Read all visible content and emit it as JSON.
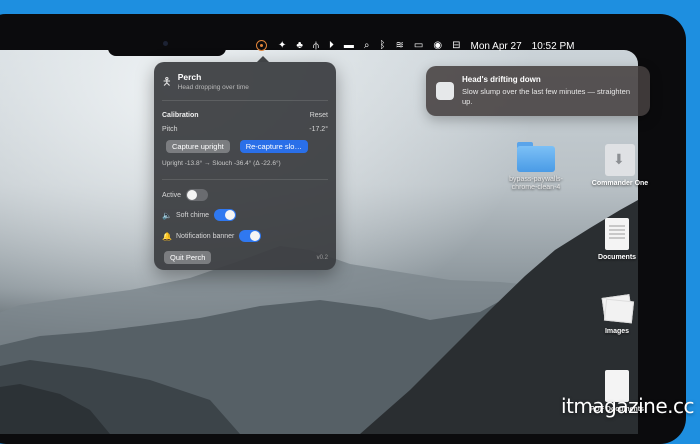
{
  "menubar": {
    "icons": [
      "perch-icon",
      "sparkle-icon",
      "badge-app-icon",
      "stand-icon",
      "play-circle-icon",
      "bed-icon",
      "search-icon",
      "bluetooth-icon",
      "wifi-icon",
      "battery-icon",
      "siri-icon",
      "control-center-icon"
    ],
    "date": "Mon Apr 27",
    "time": "10:52 PM"
  },
  "popover": {
    "app_name": "Perch",
    "subtitle": "Head dropping over time",
    "calibration_label": "Calibration",
    "reset_label": "Reset",
    "pitch_label": "Pitch",
    "pitch_value": "-17.2°",
    "capture_upright_label": "Capture upright",
    "recapture_slouch_label": "Re-capture slo…",
    "calibration_summary": "Upright -13.8° → Slouch -36.4° (Δ -22.6°)",
    "active_label": "Active",
    "active_on": false,
    "soft_chime_label": "Soft chime",
    "soft_chime_on": true,
    "notification_banner_label": "Notification banner",
    "notification_banner_on": true,
    "quit_label": "Quit Perch",
    "version": "v0.2"
  },
  "notification": {
    "title": "Head's drifting down",
    "body": "Slow slump over the last few minutes — straighten up."
  },
  "desktop": {
    "folder_label_1": "bypass-paywalls-",
    "folder_label_2": "chrome-clean-4",
    "commander_label": "Commander One",
    "documents_label": "Documents",
    "images_label": "Images",
    "pdf_label": "PDF Documents"
  },
  "watermark": "itmagazine.cc",
  "colors": {
    "accent_blue": "#2f78f0",
    "perch_orange": "#e0843a",
    "background_blue": "#1e8fe0"
  }
}
